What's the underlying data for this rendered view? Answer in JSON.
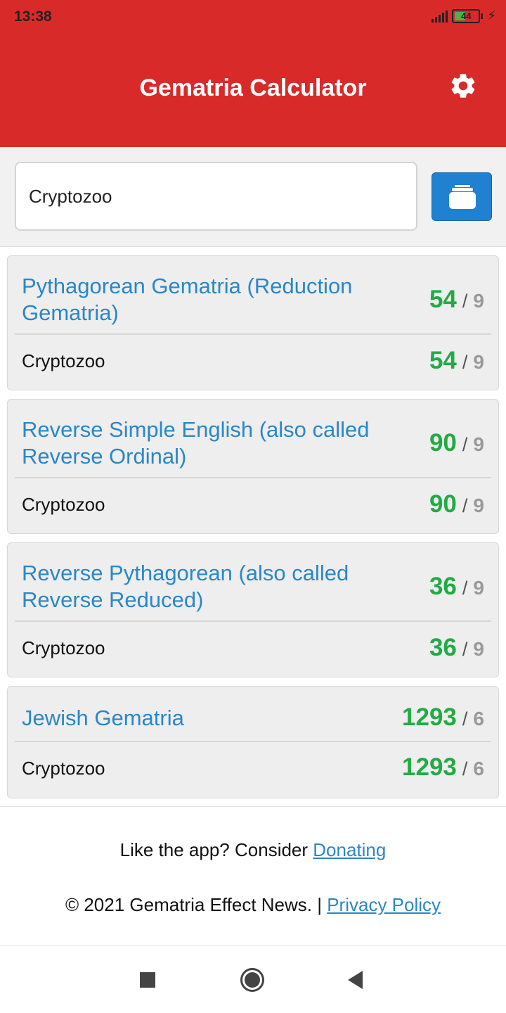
{
  "status_bar": {
    "time": "13:38",
    "battery_level": "44"
  },
  "header": {
    "title": "Gematria Calculator",
    "settings_icon": "gear-icon"
  },
  "search": {
    "value": "Cryptozoo",
    "button_icon": "calculator-icon"
  },
  "results": [
    {
      "cipher": "Pythagorean Gematria (Reduction Gematria)",
      "cipher_value": "54",
      "cipher_reduced": "9",
      "word": "Cryptozoo",
      "word_value": "54",
      "word_reduced": "9"
    },
    {
      "cipher": "Reverse Simple English (also called Reverse Ordinal)",
      "cipher_value": "90",
      "cipher_reduced": "9",
      "word": "Cryptozoo",
      "word_value": "90",
      "word_reduced": "9"
    },
    {
      "cipher": "Reverse Pythagorean (also called Reverse Reduced)",
      "cipher_value": "36",
      "cipher_reduced": "9",
      "word": "Cryptozoo",
      "word_value": "36",
      "word_reduced": "9"
    },
    {
      "cipher": "Jewish Gematria",
      "cipher_value": "1293",
      "cipher_reduced": "6",
      "word": "Cryptozoo",
      "word_value": "1293",
      "word_reduced": "6"
    }
  ],
  "separator": "/",
  "footer": {
    "donate_prefix": "Like the app? Consider ",
    "donate_link": "Donating",
    "copyright_prefix": "© 2021 Gematria Effect News. | ",
    "privacy_link": "Privacy Policy"
  },
  "colors": {
    "appbar": "#d92a2a",
    "accent_blue": "#2a87c8",
    "value_green": "#22aa44"
  }
}
